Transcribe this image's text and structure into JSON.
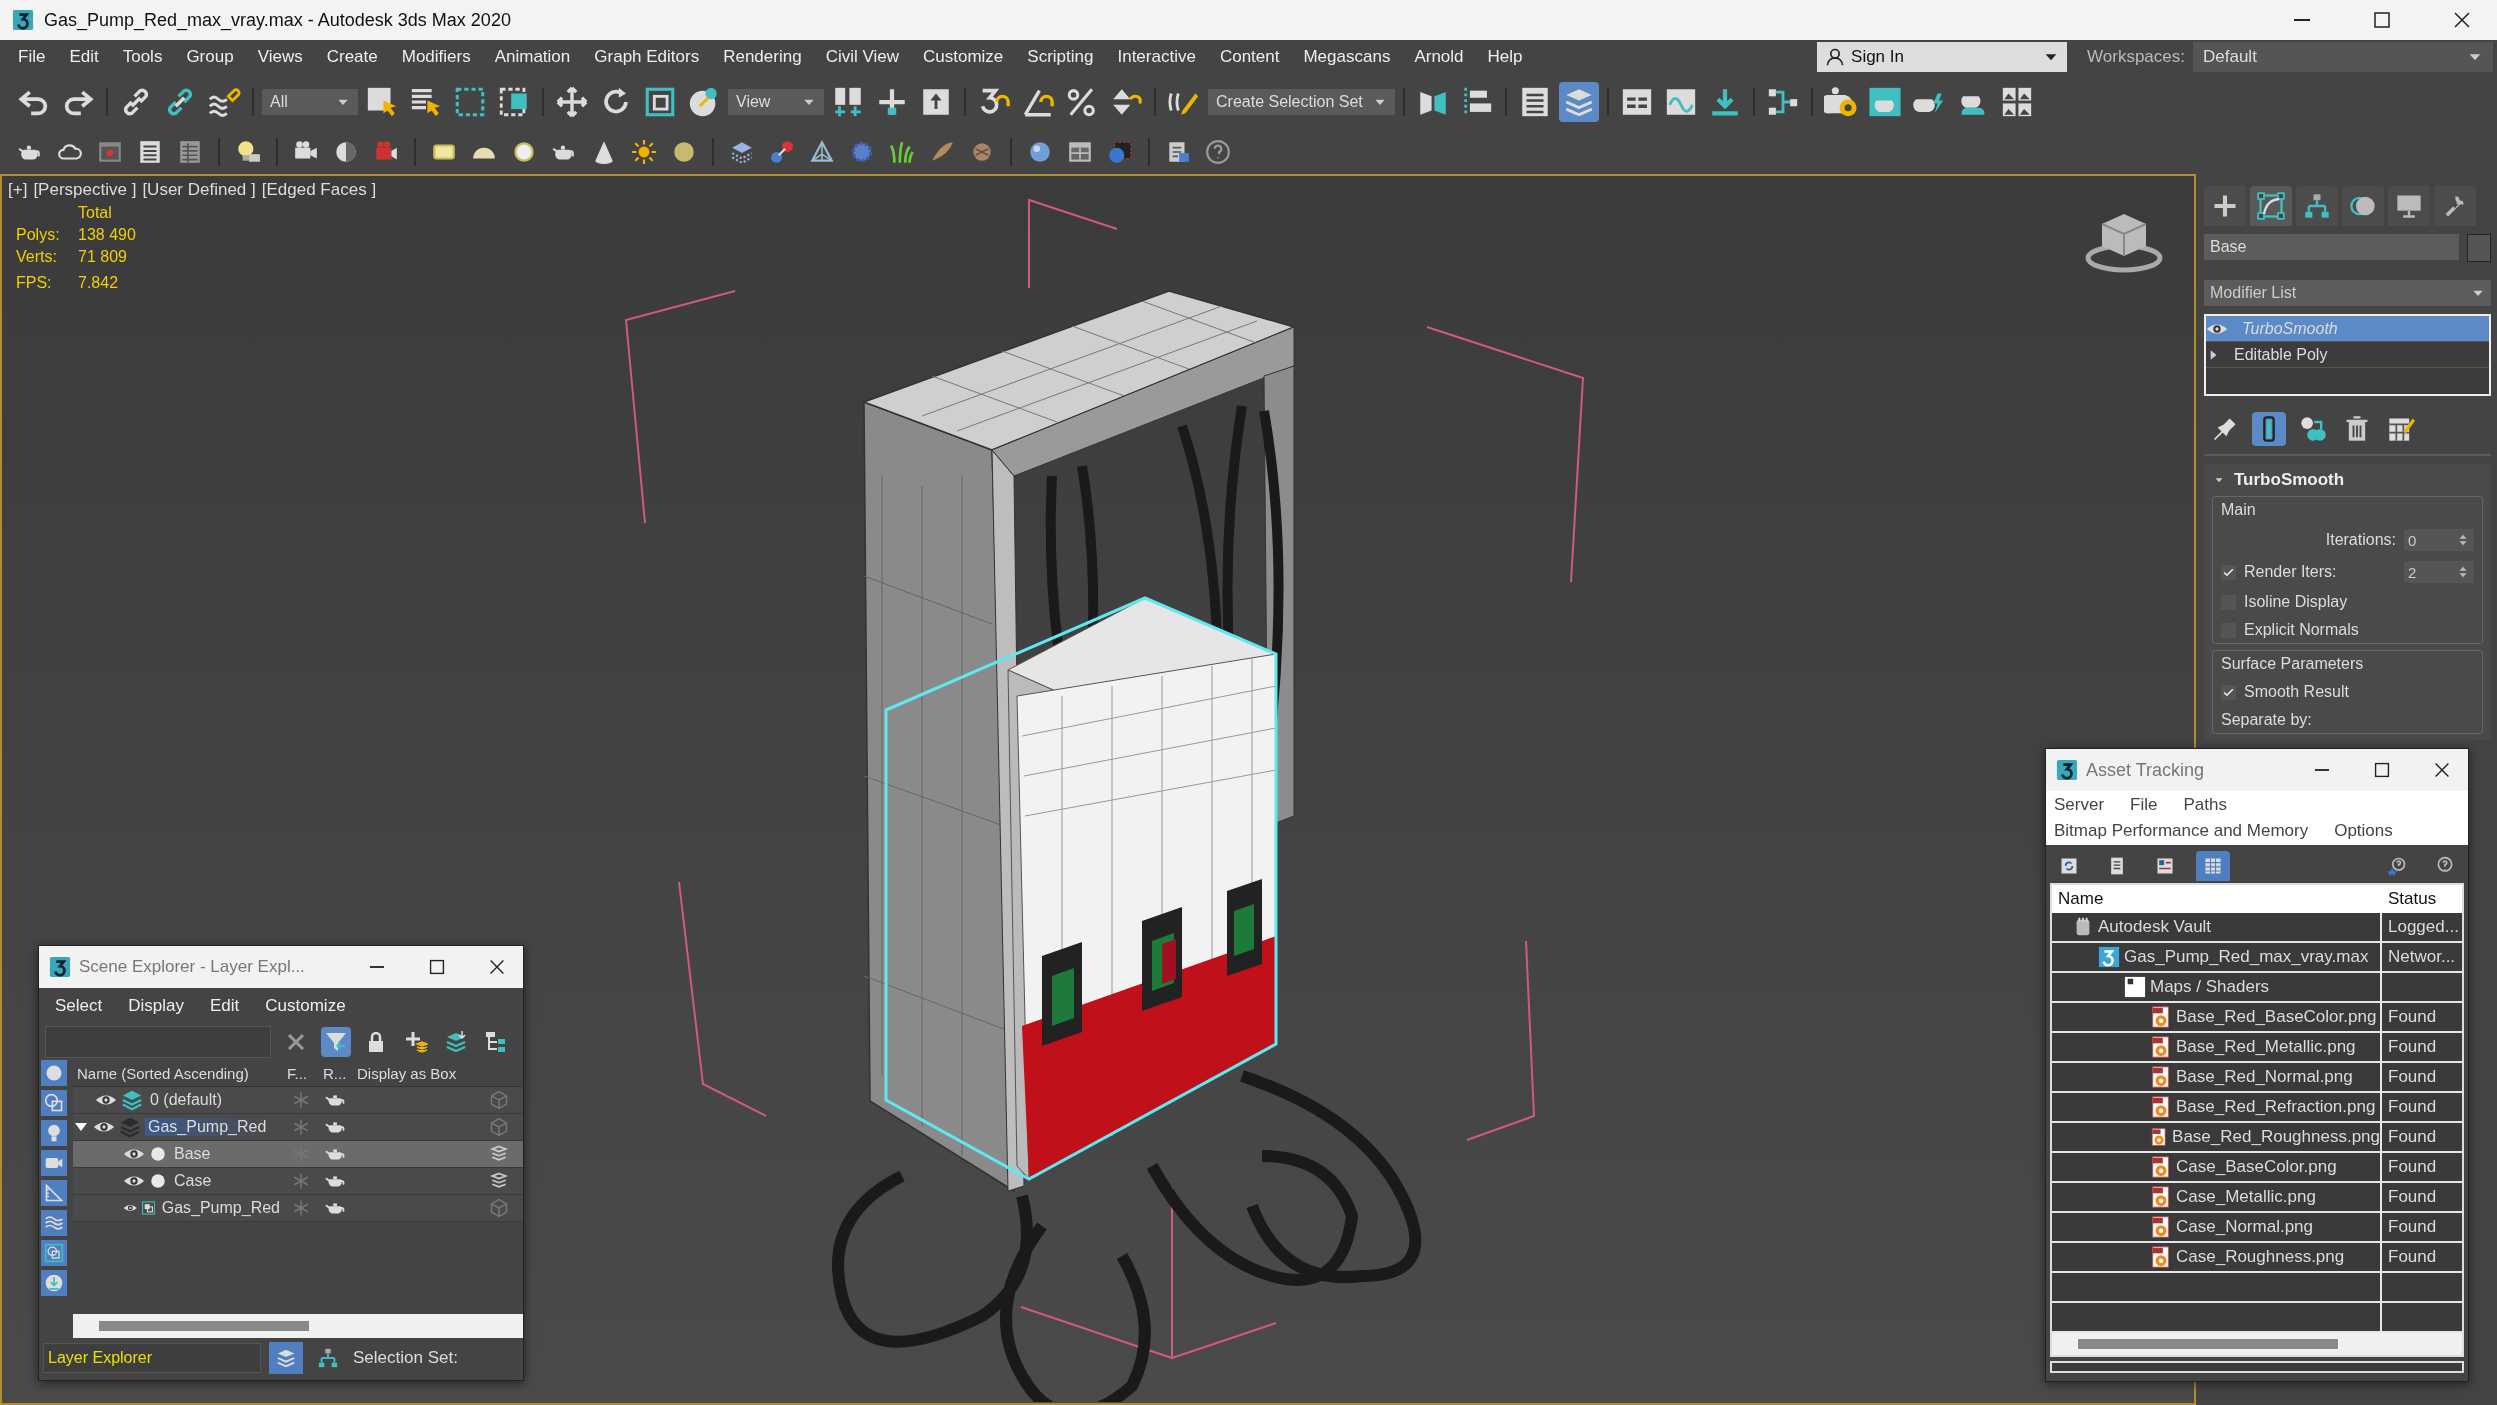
{
  "window": {
    "title": "Gas_Pump_Red_max_vray.max - Autodesk 3ds Max 2020"
  },
  "menu_bar": {
    "items": [
      "File",
      "Edit",
      "Tools",
      "Group",
      "Views",
      "Create",
      "Modifiers",
      "Animation",
      "Graph Editors",
      "Rendering",
      "Civil View",
      "Customize",
      "Scripting",
      "Interactive",
      "Content",
      "Megascans",
      "Arnold",
      "Help"
    ],
    "sign_in": "Sign In",
    "workspaces_label": "Workspaces:",
    "workspace": "Default"
  },
  "main_toolbar": {
    "items": [
      {
        "kind": "button",
        "selected": false
      },
      {
        "kind": "button",
        "selected": false
      },
      {
        "kind": "separator"
      },
      {
        "kind": "button",
        "selected": false
      },
      {
        "kind": "button",
        "selected": false
      },
      {
        "kind": "button",
        "selected": false
      },
      {
        "kind": "separator"
      },
      {
        "kind": "dropdown",
        "value": "All"
      },
      {
        "kind": "button",
        "selected": false
      },
      {
        "kind": "button",
        "selected": false
      },
      {
        "kind": "button",
        "selected": false
      },
      {
        "kind": "button",
        "selected": false
      },
      {
        "kind": "separator"
      },
      {
        "kind": "button",
        "selected": false
      },
      {
        "kind": "button",
        "selected": false
      },
      {
        "kind": "button",
        "selected": false
      },
      {
        "kind": "button",
        "selected": false
      },
      {
        "kind": "dropdown",
        "value": "View"
      },
      {
        "kind": "button",
        "selected": false
      },
      {
        "kind": "button",
        "selected": false
      },
      {
        "kind": "button",
        "selected": false
      },
      {
        "kind": "separator"
      },
      {
        "kind": "button",
        "selected": false
      },
      {
        "kind": "button",
        "selected": false
      },
      {
        "kind": "button",
        "selected": false
      },
      {
        "kind": "button",
        "selected": false
      },
      {
        "kind": "separator"
      },
      {
        "kind": "button",
        "selected": false
      },
      {
        "kind": "dropdown",
        "value": "Create Selection Set"
      },
      {
        "kind": "separator"
      },
      {
        "kind": "button",
        "selected": false
      },
      {
        "kind": "button",
        "selected": false
      },
      {
        "kind": "separator"
      },
      {
        "kind": "button",
        "selected": false
      },
      {
        "kind": "button",
        "selected": true
      },
      {
        "kind": "separator"
      },
      {
        "kind": "button",
        "selected": false
      },
      {
        "kind": "button",
        "selected": false
      },
      {
        "kind": "button",
        "selected": false
      },
      {
        "kind": "separator"
      },
      {
        "kind": "button",
        "selected": false
      },
      {
        "kind": "separator"
      },
      {
        "kind": "button",
        "selected": false
      },
      {
        "kind": "button",
        "selected": false
      },
      {
        "kind": "button",
        "selected": false
      },
      {
        "kind": "button",
        "selected": false
      },
      {
        "kind": "button",
        "selected": false
      }
    ]
  },
  "viewport": {
    "labels": [
      "[+]",
      "[Perspective ]",
      "[User Defined ]",
      "[Edged Faces ]"
    ],
    "stats_header": "Total",
    "stats": [
      {
        "label": "Polys:",
        "value": "138 490"
      },
      {
        "label": "Verts:",
        "value": "71 809"
      }
    ],
    "fps_label": "FPS:",
    "fps": "7.842"
  },
  "command_panel": {
    "tabs": [
      {
        "selected": false
      },
      {
        "selected": true
      },
      {
        "selected": false
      },
      {
        "selected": false
      },
      {
        "selected": false
      },
      {
        "selected": false
      }
    ],
    "object_name": "Base",
    "modifier_list": "Modifier List",
    "stack": [
      {
        "label": "TurboSmooth",
        "selected": true,
        "italic": true
      },
      {
        "label": "Editable Poly",
        "selected": false,
        "italic": false
      }
    ],
    "stack_tools": [
      {
        "selected": false
      },
      {
        "selected": true
      },
      {
        "selected": false
      },
      {
        "selected": false
      },
      {
        "selected": false
      }
    ],
    "rollout": {
      "title": "TurboSmooth",
      "expanded": true,
      "groups": [
        {
          "title": "Main",
          "rows": [
            {
              "kind": "spinner",
              "label": "Iterations:",
              "value": "0"
            },
            {
              "kind": "check_spinner",
              "label": "Render Iters:",
              "checked": true,
              "value": "2"
            },
            {
              "kind": "checkbox",
              "label": "Isoline Display",
              "checked": false
            },
            {
              "kind": "checkbox",
              "label": "Explicit Normals",
              "checked": false
            }
          ]
        },
        {
          "title": "Surface Parameters",
          "rows": [
            {
              "kind": "checkbox",
              "label": "Smooth Result",
              "checked": true
            },
            {
              "kind": "label",
              "label": "Separate by:"
            }
          ]
        }
      ]
    }
  },
  "scene_explorer": {
    "title": "Scene Explorer - Layer Expl...",
    "menu": [
      "Select",
      "Display",
      "Edit",
      "Customize"
    ],
    "tools": [
      {
        "selected": false
      },
      {
        "selected": true
      },
      {
        "selected": false
      },
      {
        "selected": false
      },
      {
        "selected": false
      },
      {
        "selected": false
      }
    ],
    "filters": [
      {
        "selected": true
      },
      {
        "selected": true
      },
      {
        "selected": true
      },
      {
        "selected": true
      },
      {
        "selected": true
      },
      {
        "selected": true
      },
      {
        "selected": true
      },
      {
        "selected": true
      }
    ],
    "columns": [
      "Name (Sorted Ascending)",
      "F...",
      "R...",
      "Display as Box"
    ],
    "rows": [
      {
        "name": "0 (default)",
        "kind": "layer",
        "current": true,
        "selected": false
      },
      {
        "name": "Gas_Pump_Red",
        "kind": "layer",
        "current": false,
        "selected": true,
        "expanded": true,
        "children": [
          {
            "name": "Base",
            "kind": "object",
            "selected": true
          },
          {
            "name": "Case",
            "kind": "object",
            "selected": false
          },
          {
            "name": "Gas_Pump_Red",
            "kind": "group",
            "selected": false
          }
        ]
      }
    ],
    "explorer_type": "Layer Explorer",
    "bottom_tools": [
      {
        "selected": true
      },
      {
        "selected": false
      }
    ],
    "selection_set_label": "Selection Set:"
  },
  "asset_tracking": {
    "title": "Asset Tracking",
    "menu_rows": [
      [
        "Server",
        "File",
        "Paths"
      ],
      [
        "Bitmap Performance and Memory",
        "Options"
      ]
    ],
    "tools": [
      {
        "selected": false
      },
      {
        "selected": false
      },
      {
        "selected": false
      },
      {
        "selected": true
      }
    ],
    "columns": [
      "Name",
      "Status"
    ],
    "rows": [
      {
        "name": "Autodesk Vault",
        "kind": "vault",
        "status": "Logged...",
        "children": [
          {
            "name": "Gas_Pump_Red_max_vray.max",
            "kind": "max",
            "status": "Networ...",
            "children": [
              {
                "name": "Maps / Shaders",
                "kind": "folder",
                "children": [
                  {
                    "name": "Base_Red_BaseColor.png",
                    "kind": "bitmap",
                    "status": "Found"
                  },
                  {
                    "name": "Base_Red_Metallic.png",
                    "kind": "bitmap",
                    "status": "Found"
                  },
                  {
                    "name": "Base_Red_Normal.png",
                    "kind": "bitmap",
                    "status": "Found"
                  },
                  {
                    "name": "Base_Red_Refraction.png",
                    "kind": "bitmap",
                    "status": "Found"
                  },
                  {
                    "name": "Base_Red_Roughness.png",
                    "kind": "bitmap",
                    "status": "Found"
                  },
                  {
                    "name": "Case_BaseColor.png",
                    "kind": "bitmap",
                    "status": "Found"
                  },
                  {
                    "name": "Case_Metallic.png",
                    "kind": "bitmap",
                    "status": "Found"
                  },
                  {
                    "name": "Case_Normal.png",
                    "kind": "bitmap",
                    "status": "Found"
                  },
                  {
                    "name": "Case_Roughness.png",
                    "kind": "bitmap",
                    "status": "Found"
                  }
                ]
              }
            ]
          }
        ]
      }
    ]
  }
}
